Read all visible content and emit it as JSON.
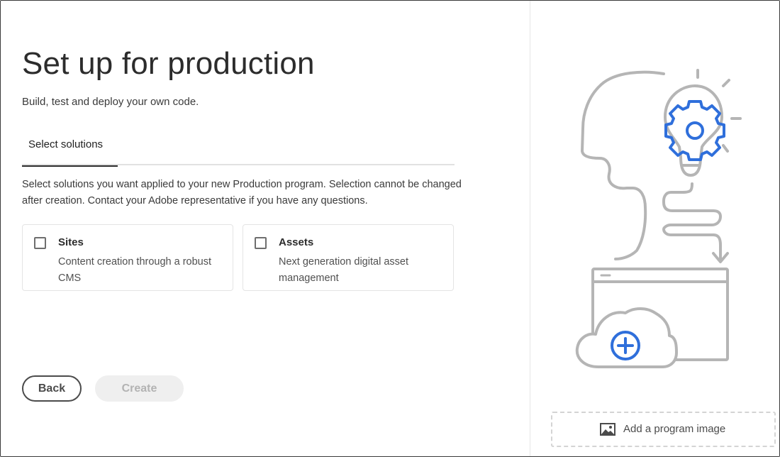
{
  "page": {
    "title": "Set up for production",
    "subtitle": "Build, test and deploy your own code."
  },
  "tabs": [
    {
      "label": "Select solutions",
      "selected": true
    }
  ],
  "description": "Select solutions you want applied to your new Production program. Selection cannot be changed after creation. Contact your Adobe representative if you have any questions.",
  "solutions": [
    {
      "title": "Sites",
      "description": "Content creation through a robust CMS",
      "checked": false
    },
    {
      "title": "Assets",
      "description": "Next generation digital asset management",
      "checked": false
    }
  ],
  "actions": {
    "back_label": "Back",
    "create_label": "Create",
    "create_disabled": true
  },
  "program_image": {
    "label": "Add a program image",
    "icon": "image-icon"
  },
  "illustration": {
    "icons": [
      "head-outline-icon",
      "lightbulb-icon",
      "gear-icon",
      "browser-window-icon",
      "cloud-icon",
      "plus-icon"
    ],
    "colors": {
      "outline": "#b5b5b5",
      "accent": "#2f6fdb"
    }
  }
}
